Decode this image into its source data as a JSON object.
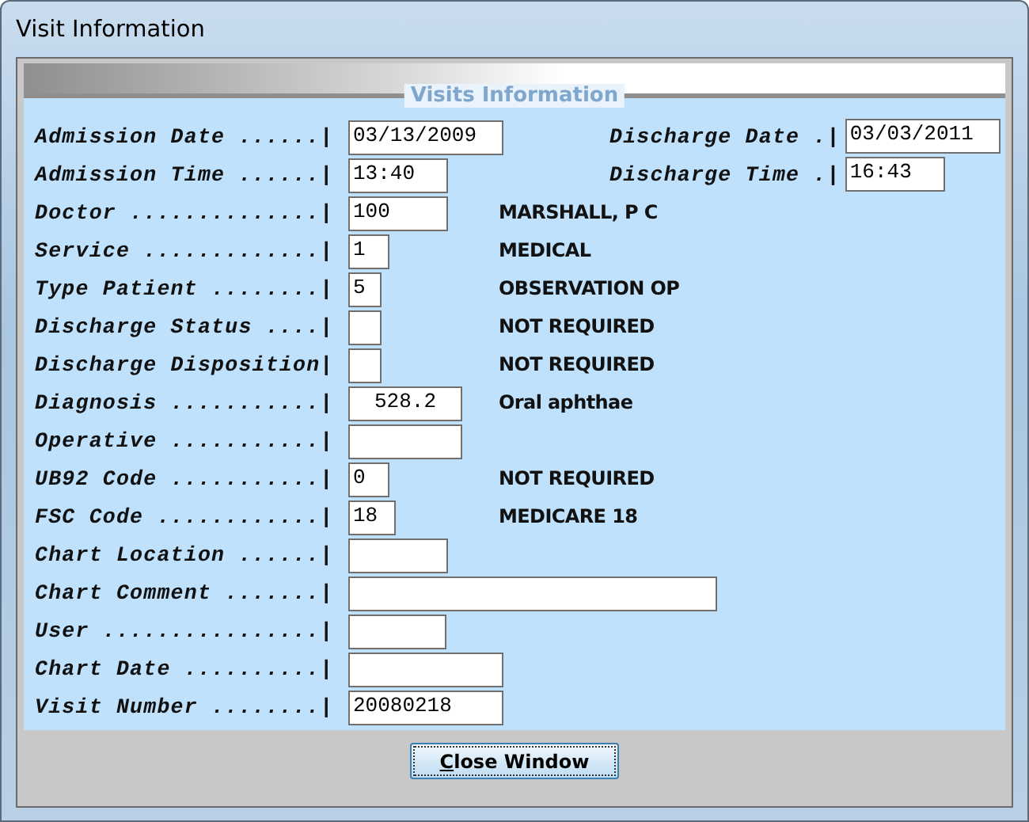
{
  "window": {
    "title": "Visit Information"
  },
  "panel": {
    "title": "Visits Information"
  },
  "rows": [
    {
      "label": "Admission Date ......|",
      "value": "03/13/2009",
      "right": {
        "label": "Discharge Date .|",
        "value": "03/03/2011"
      }
    },
    {
      "label": "Admission Time ......|",
      "value": "13:40",
      "right": {
        "label": "Discharge Time .|",
        "value": "16:43"
      }
    },
    {
      "label": "Doctor ..............|",
      "value": "100",
      "description": "MARSHALL, P C"
    },
    {
      "label": "Service .............|",
      "value": "1",
      "description": "MEDICAL"
    },
    {
      "label": "Type Patient ........|",
      "value": "5",
      "description": "OBSERVATION OP"
    },
    {
      "label": "Discharge Status ....|",
      "description": "NOT REQUIRED"
    },
    {
      "label": "Discharge Disposition|",
      "description": "NOT REQUIRED"
    },
    {
      "label": "Diagnosis ...........|",
      "value": "528.2",
      "description": "Oral aphthae"
    },
    {
      "label": "Operative ...........|"
    },
    {
      "label": "UB92 Code ...........|",
      "value": "0",
      "description": "NOT REQUIRED"
    },
    {
      "label": "FSC Code ............|",
      "value": "18",
      "description": "MEDICARE 18"
    },
    {
      "label": "Chart Location ......|"
    },
    {
      "label": "Chart Comment .......|"
    },
    {
      "label": "User ................|"
    },
    {
      "label": "Chart Date ..........|"
    },
    {
      "label": "Visit Number ........|",
      "value": "20080218"
    }
  ],
  "buttons": [
    {
      "label": "Close Window"
    }
  ]
}
